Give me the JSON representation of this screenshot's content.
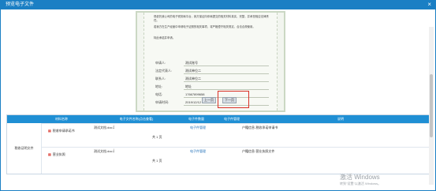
{
  "dialog": {
    "title": "预览电子文件",
    "close_glyph": "×"
  },
  "certificate": {
    "paragraphs": [
      "现依托我公司的电子税务局平台，我方保证向你局提交的相关材料真实、完整，并承担相应法律责任。",
      "若我方在生产经营中申请电子证照的相关事项，将严格遵守相关规定，合法合规使用。",
      "特此承诺并申请。"
    ],
    "fields": [
      {
        "label": "申请人:",
        "value": "测试账号"
      },
      {
        "label": "法定代表人:",
        "value": "测试单位二"
      },
      {
        "label": "联系人:",
        "value": "测试单位二"
      },
      {
        "label": "地址:",
        "value": "地址"
      },
      {
        "label": "电话:",
        "value": "17667899658"
      },
      {
        "label": "申请时间:",
        "value": "2019/12/12 09:58"
      }
    ],
    "prev_label": "上一页",
    "next_label": "下一页"
  },
  "table": {
    "headers": [
      "材料名称",
      "电子文件名称(点击查看)",
      "电子件数量",
      "电子件管理",
      "说明"
    ],
    "group_label": "税收证明文件",
    "rows": [
      {
        "name": "税收申请承诺书",
        "file": "测试文档.doc",
        "pages": "共 1 页",
        "manage": "电子件管理",
        "note": "户籍信息-税收承诺申请书"
      },
      {
        "name": "营业执照",
        "file": "测试文档.doc",
        "pages": "共 1 页",
        "manage": "电子件管理",
        "note": "户籍信息-营业执照文件"
      }
    ]
  },
  "watermark": {
    "line1": "激活 Windows",
    "line2": "转到\"设置\"以激活 Windows。"
  },
  "colors": {
    "accent": "#1b7fc4",
    "header": "#1f8fd4",
    "highlight": "#d93025"
  }
}
